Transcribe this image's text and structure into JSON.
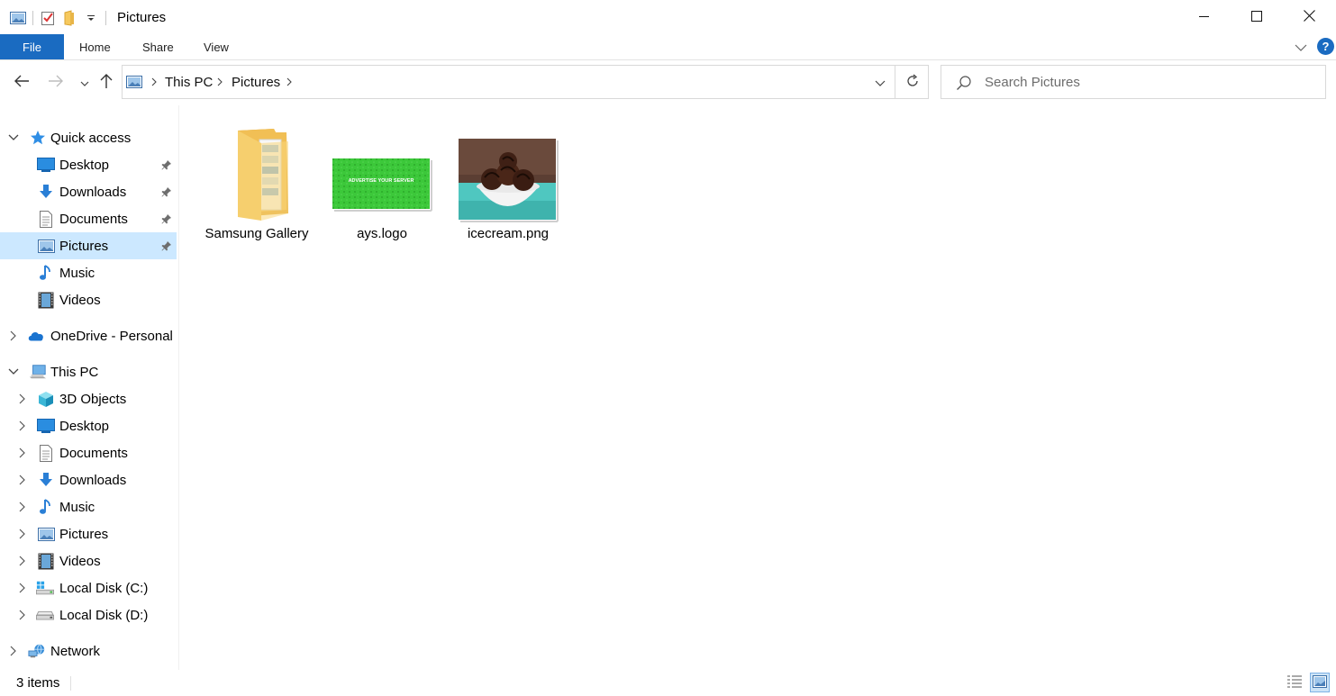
{
  "window": {
    "title": "Pictures",
    "minimize_icon": "minimize-icon",
    "maximize_icon": "maximize-icon",
    "close_icon": "close-icon"
  },
  "ribbon": {
    "tabs": [
      {
        "label": "File"
      },
      {
        "label": "Home"
      },
      {
        "label": "Share"
      },
      {
        "label": "View"
      }
    ],
    "help_label": "?",
    "accent_color": "#1a6bc1"
  },
  "address": {
    "crumbs": [
      "This PC",
      "Pictures"
    ],
    "search_placeholder": "Search Pictures"
  },
  "navpane": {
    "quick_access": {
      "label": "Quick access",
      "items": [
        {
          "label": "Desktop",
          "icon": "desktop-icon",
          "pinned": true
        },
        {
          "label": "Downloads",
          "icon": "downloads-icon",
          "pinned": true
        },
        {
          "label": "Documents",
          "icon": "documents-icon",
          "pinned": true
        },
        {
          "label": "Pictures",
          "icon": "pictures-icon",
          "pinned": true,
          "selected": true
        },
        {
          "label": "Music",
          "icon": "music-icon"
        },
        {
          "label": "Videos",
          "icon": "videos-icon"
        }
      ]
    },
    "onedrive": {
      "label": "OneDrive - Personal",
      "icon": "onedrive-icon"
    },
    "this_pc": {
      "label": "This PC",
      "items": [
        {
          "label": "3D Objects",
          "icon": "3d-objects-icon"
        },
        {
          "label": "Desktop",
          "icon": "desktop-icon"
        },
        {
          "label": "Documents",
          "icon": "documents-icon"
        },
        {
          "label": "Downloads",
          "icon": "downloads-icon"
        },
        {
          "label": "Music",
          "icon": "music-icon"
        },
        {
          "label": "Pictures",
          "icon": "pictures-icon"
        },
        {
          "label": "Videos",
          "icon": "videos-icon"
        },
        {
          "label": "Local Disk (C:)",
          "icon": "drive-c-icon"
        },
        {
          "label": "Local Disk (D:)",
          "icon": "drive-d-icon"
        }
      ]
    },
    "network": {
      "label": "Network",
      "icon": "network-icon"
    }
  },
  "files": [
    {
      "name": "Samsung Gallery",
      "kind": "folder",
      "icon": "folder-icon"
    },
    {
      "name": "ays.logo",
      "kind": "image",
      "icon": "image-thumbnail",
      "thumb_text": "ADVERTISE YOUR SERVER",
      "thumb_color": "#3cc83a"
    },
    {
      "name": "icecream.png",
      "kind": "image",
      "icon": "image-thumbnail",
      "thumb_color": "#4fc7c0"
    }
  ],
  "status": {
    "item_count": "3 items",
    "views": [
      "details-view",
      "large-icons-view"
    ],
    "active_view": "large-icons-view"
  },
  "colors": {
    "selection": "#cce8ff",
    "folder": "#f6c95e"
  }
}
